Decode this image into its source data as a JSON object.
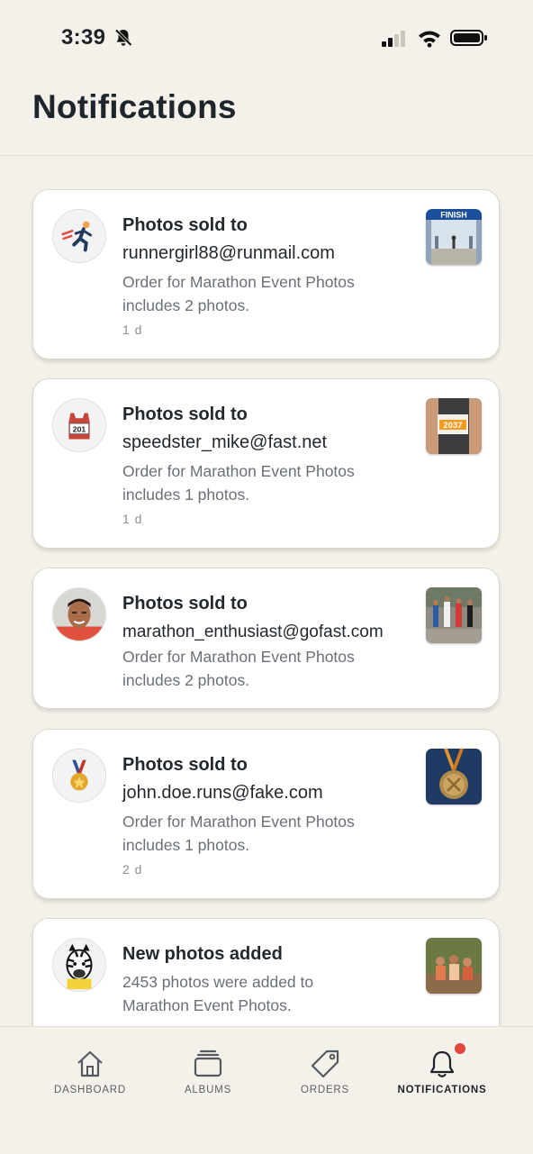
{
  "status_bar": {
    "time": "3:39",
    "icons": [
      "mute-bell-icon",
      "cellular-signal-icon",
      "wifi-icon",
      "battery-icon"
    ]
  },
  "header": {
    "title": "Notifications"
  },
  "notifications": [
    {
      "title": "Photos sold to",
      "subtitle": "runnergirl88@runmail.com",
      "body": [
        "Order for Marathon Event Photos",
        "includes 2 photos."
      ],
      "time": "1 d",
      "avatar_icon": "runner-icon",
      "thumbnail": {
        "icon": "finish-line-photo",
        "text": "FINISH"
      }
    },
    {
      "title": "Photos sold to",
      "subtitle": "speedster_mike@fast.net",
      "body": [
        "Order for Marathon Event Photos",
        "includes 1 photos."
      ],
      "time": "1 d",
      "avatar_icon": "race-bib-icon",
      "avatar_text": "201",
      "thumbnail": {
        "icon": "race-bib-photo",
        "text": "2037"
      }
    },
    {
      "title": "Photos sold to",
      "subtitle": "marathon_enthusiast@gofast.com",
      "body": [
        "Order for Marathon Event Photos",
        "includes 2 photos."
      ],
      "time": "",
      "avatar_icon": "user-photo-avatar",
      "thumbnail": {
        "icon": "runners-crowd-photo"
      }
    },
    {
      "title": "Photos sold to",
      "subtitle": "john.doe.runs@fake.com",
      "body": [
        "Order for Marathon Event Photos",
        "includes 1 photos."
      ],
      "time": "2 d",
      "avatar_icon": "medal-icon",
      "thumbnail": {
        "icon": "medal-photo"
      }
    },
    {
      "title": "New photos added",
      "subtitle": "",
      "body": [
        "2453 photos were added to",
        "Marathon Event Photos."
      ],
      "time": "",
      "avatar_icon": "zebra-mascot-icon",
      "thumbnail": {
        "icon": "group-photo"
      }
    }
  ],
  "bottom_nav": [
    {
      "label": "DASHBOARD",
      "icon": "house-icon"
    },
    {
      "label": "ALBUMS",
      "icon": "albums-icon"
    },
    {
      "label": "ORDERS",
      "icon": "tag-icon"
    },
    {
      "label": "NOTIFICATIONS",
      "icon": "bell-icon",
      "active": true,
      "has_badge": true
    }
  ],
  "colors": {
    "background": "#f4f1ea",
    "card": "#ffffff",
    "badge": "#e0483e",
    "title_text": "#1e252b",
    "muted_text": "#6b7077"
  }
}
